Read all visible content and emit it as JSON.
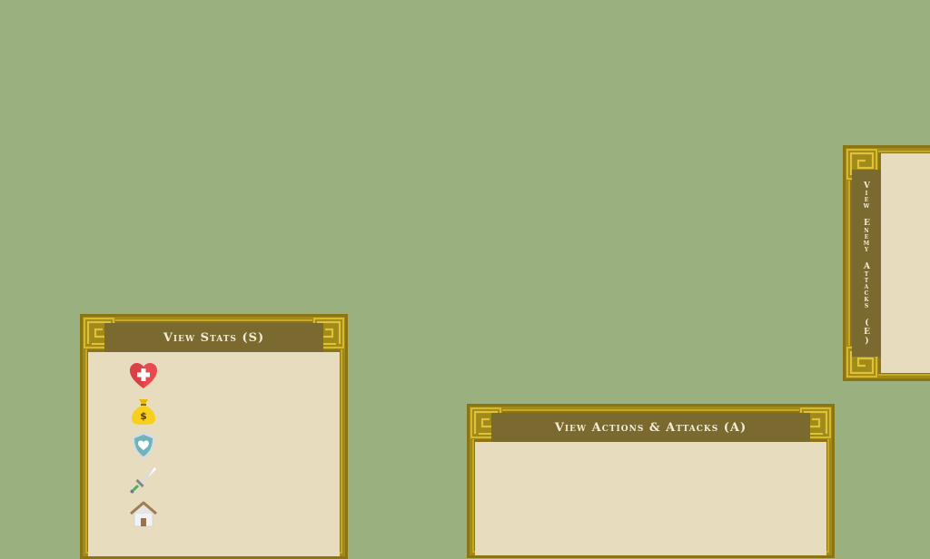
{
  "panels": {
    "stats": {
      "title": "View Stats (S)"
    },
    "actions": {
      "title": "View Actions & Attacks (A)"
    },
    "enemy": {
      "title": "View Enemy Attacks (E)"
    }
  },
  "stat_icons": [
    "health-heart-icon",
    "money-bag-icon",
    "shield-icon",
    "sword-icon",
    "home-icon"
  ],
  "colors": {
    "background": "#9bb07f",
    "panel_gold": "#c7a826",
    "panel_header": "#7a6a30",
    "panel_content": "#e8dcbf",
    "header_text": "#f4ecd6"
  }
}
